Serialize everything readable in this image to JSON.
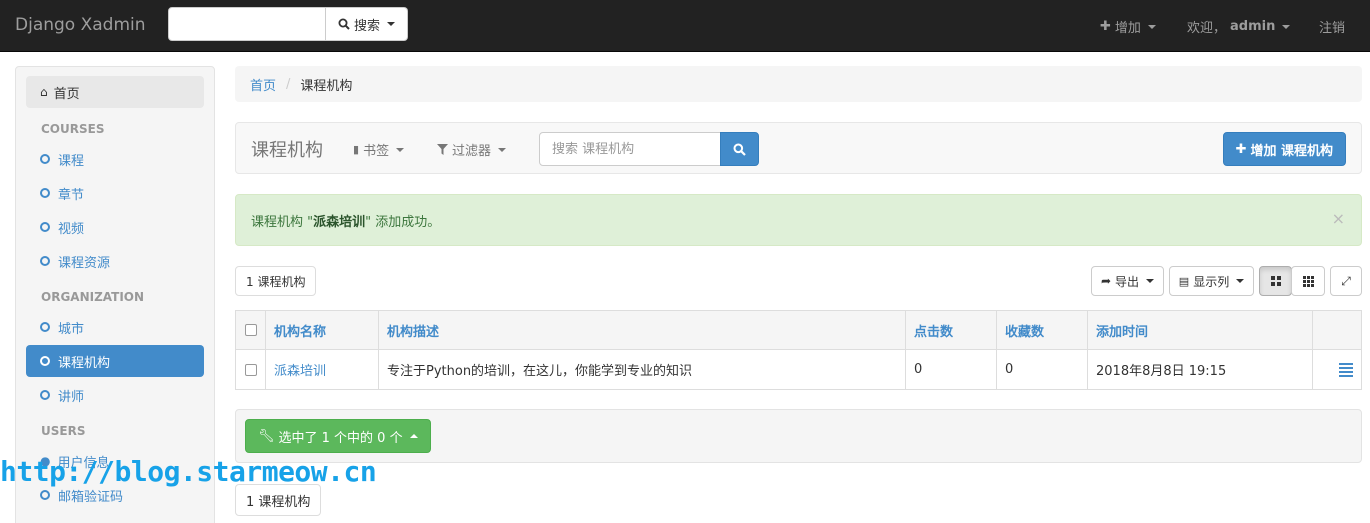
{
  "navbar": {
    "brand": "Django Xadmin",
    "search_button_label": "搜索",
    "add_label": "增加",
    "welcome_prefix": "欢迎，",
    "username": "admin",
    "logout_label": "注销"
  },
  "sidebar": {
    "home_label": "首页",
    "sections": [
      {
        "header": "COURSES",
        "items": [
          "课程",
          "章节",
          "视频",
          "课程资源"
        ]
      },
      {
        "header": "ORGANIZATION",
        "items": [
          "城市",
          "课程机构",
          "讲师"
        ]
      },
      {
        "header": "USERS",
        "items": [
          "用户信息",
          "邮箱验证码"
        ]
      }
    ],
    "active_item": "课程机构"
  },
  "breadcrumb": {
    "home": "首页",
    "current": "课程机构"
  },
  "toolbar": {
    "title": "课程机构",
    "bookmarks_label": "书签",
    "filters_label": "过滤器",
    "search_placeholder": "搜索 课程机构",
    "add_button_label": "增加 课程机构"
  },
  "alert": {
    "prefix": "课程机构 \"",
    "object_name": "派森培训",
    "suffix": "\" 添加成功。",
    "close": "×"
  },
  "results": {
    "count_label_top": "1 课程机构",
    "count_label_bottom": "1 课程机构",
    "export_label": "导出",
    "columns_label": "显示列"
  },
  "table": {
    "headers": [
      "机构名称",
      "机构描述",
      "点击数",
      "收藏数",
      "添加时间"
    ],
    "rows": [
      [
        "派森培训",
        "专注于Python的培训，在这儿，你能学到专业的知识",
        "0",
        "0",
        "2018年8月8日 19:15"
      ]
    ]
  },
  "actions": {
    "selection_label": "选中了 1 个中的 0 个"
  },
  "watermark": "http://blog.starmeow.cn",
  "colors": {
    "primary": "#428bca",
    "success": "#5cb85c",
    "navbar": "#222222",
    "watermark": "#17a2e8"
  }
}
